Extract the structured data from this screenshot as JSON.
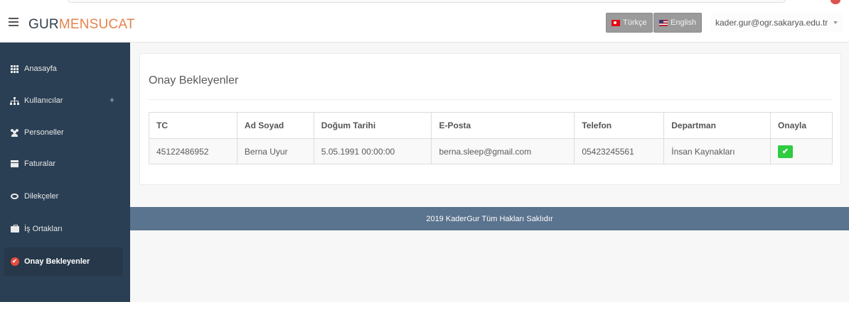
{
  "header": {
    "logo_part1": "GUR",
    "logo_part2": "MENSUCAT",
    "lang_tr": "Türkçe",
    "lang_en": "English",
    "user_email": "kader.gur@ogr.sakarya.edu.tr"
  },
  "sidebar": {
    "items": [
      {
        "label": "Anasayfa",
        "icon": "grid-icon"
      },
      {
        "label": "Kullanıcılar",
        "icon": "sitemap-icon",
        "expand": "+"
      },
      {
        "label": "Personeller",
        "icon": "users-icon"
      },
      {
        "label": "Faturalar",
        "icon": "archive-icon"
      },
      {
        "label": "Dilekçeler",
        "icon": "comments-icon"
      },
      {
        "label": "İş Ortakları",
        "icon": "briefcase-icon"
      },
      {
        "label": "Onay Bekleyenler",
        "icon": "check-circle-icon"
      }
    ]
  },
  "main": {
    "title": "Onay Bekleyenler",
    "table": {
      "headers": [
        "TC",
        "Ad Soyad",
        "Doğum Tarihi",
        "E-Posta",
        "Telefon",
        "Departman",
        "Onayla"
      ],
      "rows": [
        [
          "45122486952",
          "Berna Uyur",
          "5.05.1991 00:00:00",
          "berna.sleep@gmail.com",
          "05423245561",
          "İnsan Kaynakları"
        ]
      ]
    },
    "footer": "2019 KaderGur Tüm Hakları Saklıdır"
  },
  "colors": {
    "sidebar_bg": "#2a3f54",
    "footer_bg": "#5a738e",
    "accent_orange": "#e6834c",
    "approve_green": "#2ecc40",
    "active_icon_red": "#e74c3c"
  }
}
